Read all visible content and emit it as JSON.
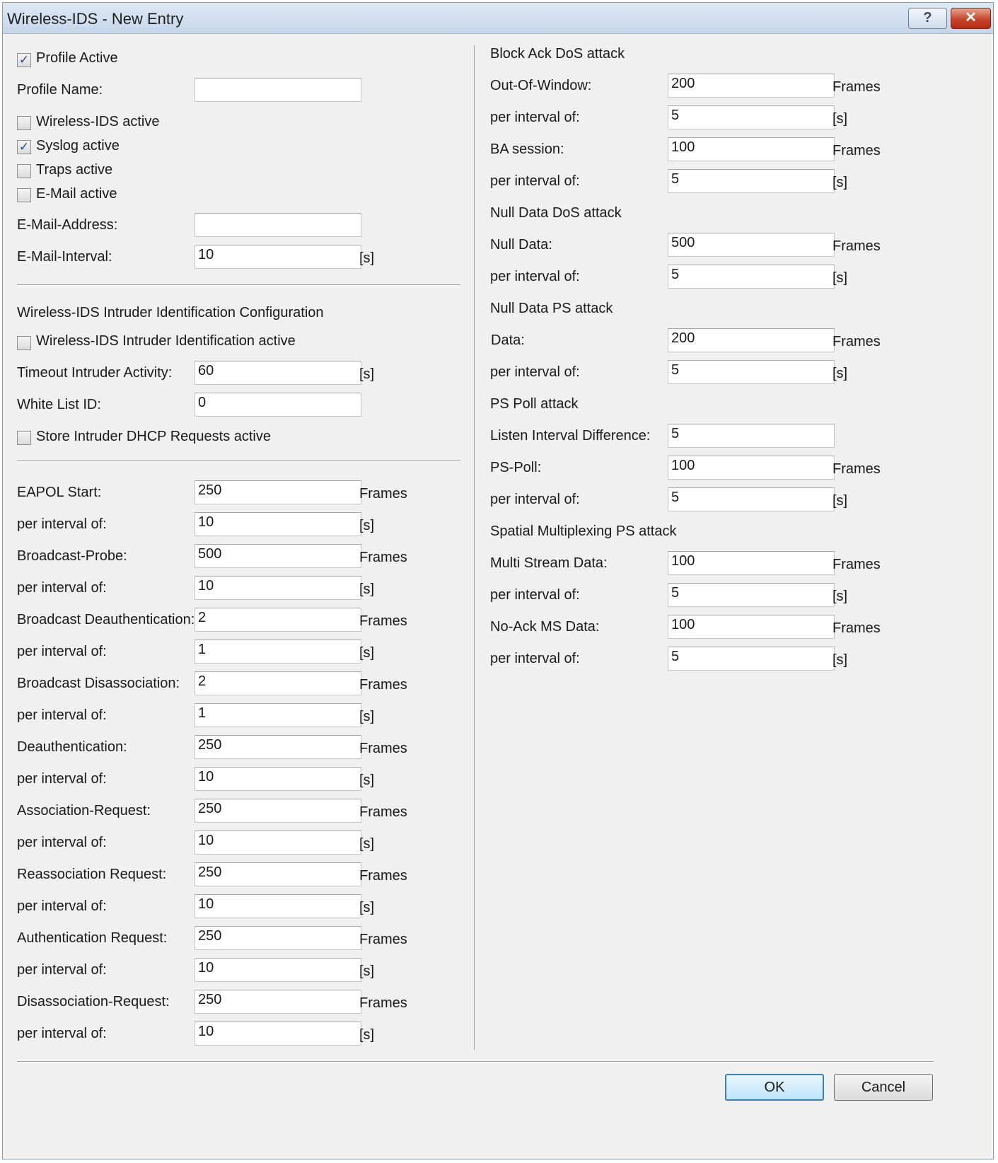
{
  "window": {
    "title": "Wireless-IDS - New Entry",
    "help_glyph": "?",
    "close_glyph": "✕"
  },
  "checkbox_glyph": "✓",
  "general": {
    "profile_active": {
      "label": "Profile Active",
      "checked": true
    },
    "profile_name": {
      "label": "Profile Name:",
      "value": ""
    },
    "wids_active": {
      "label": "Wireless-IDS active",
      "checked": false
    },
    "syslog_active": {
      "label": "Syslog active",
      "checked": true
    },
    "traps_active": {
      "label": "Traps active",
      "checked": false
    },
    "email_active": {
      "label": "E-Mail active",
      "checked": false
    },
    "email_address": {
      "label": "E-Mail-Address:",
      "value": ""
    },
    "email_interval": {
      "label": "E-Mail-Interval:",
      "value": "10",
      "unit": "[s]"
    }
  },
  "intruder": {
    "heading": "Wireless-IDS Intruder Identification Configuration",
    "active": {
      "label": "Wireless-IDS Intruder Identification active",
      "checked": false
    },
    "timeout": {
      "label": "Timeout Intruder Activity:",
      "value": "60",
      "unit": "[s]"
    },
    "whitelist": {
      "label": "White List ID:",
      "value": "0"
    },
    "store_dhcp": {
      "label": "Store Intruder DHCP Requests active",
      "checked": false
    }
  },
  "thresholds": [
    {
      "label": "EAPOL Start:",
      "value": "250",
      "unit": "Frames"
    },
    {
      "label": "per interval of:",
      "value": "10",
      "unit": "[s]"
    },
    {
      "label": "Broadcast-Probe:",
      "value": "500",
      "unit": "Frames"
    },
    {
      "label": "per interval of:",
      "value": "10",
      "unit": "[s]"
    },
    {
      "label": "Broadcast Deauthentication:",
      "value": "2",
      "unit": "Frames"
    },
    {
      "label": "per interval of:",
      "value": "1",
      "unit": "[s]"
    },
    {
      "label": "Broadcast Disassociation:",
      "value": "2",
      "unit": "Frames"
    },
    {
      "label": "per interval of:",
      "value": "1",
      "unit": "[s]"
    },
    {
      "label": "Deauthentication:",
      "value": "250",
      "unit": "Frames"
    },
    {
      "label": "per interval of:",
      "value": "10",
      "unit": "[s]"
    },
    {
      "label": "Association-Request:",
      "value": "250",
      "unit": "Frames"
    },
    {
      "label": "per interval of:",
      "value": "10",
      "unit": "[s]"
    },
    {
      "label": "Reassociation Request:",
      "value": "250",
      "unit": "Frames"
    },
    {
      "label": "per interval of:",
      "value": "10",
      "unit": "[s]"
    },
    {
      "label": "Authentication Request:",
      "value": "250",
      "unit": "Frames"
    },
    {
      "label": "per interval of:",
      "value": "10",
      "unit": "[s]"
    },
    {
      "label": "Disassociation-Request:",
      "value": "250",
      "unit": "Frames"
    },
    {
      "label": "per interval of:",
      "value": "10",
      "unit": "[s]"
    }
  ],
  "right": {
    "block_ack": {
      "heading": "Block Ack DoS attack",
      "out_of_window": {
        "label": "Out-Of-Window:",
        "value": "200",
        "unit": "Frames"
      },
      "oow_interval": {
        "label": "per interval of:",
        "value": "5",
        "unit": "[s]"
      },
      "ba_session": {
        "label": "BA session:",
        "value": "100",
        "unit": "Frames"
      },
      "ba_interval": {
        "label": "per interval of:",
        "value": "5",
        "unit": "[s]"
      }
    },
    "null_data_dos": {
      "heading": "Null Data DoS attack",
      "null_data": {
        "label": "Null Data:",
        "value": "500",
        "unit": "Frames"
      },
      "interval": {
        "label": "per interval of:",
        "value": "5",
        "unit": "[s]"
      }
    },
    "null_data_ps": {
      "heading": "Null Data PS attack",
      "data": {
        "label": "Data:",
        "value": "200",
        "unit": "Frames"
      },
      "interval": {
        "label": "per interval of:",
        "value": "5",
        "unit": "[s]"
      }
    },
    "ps_poll": {
      "heading": "PS Poll attack",
      "listen_diff": {
        "label": "Listen Interval Difference:",
        "value": "5"
      },
      "ps_poll": {
        "label": "PS-Poll:",
        "value": "100",
        "unit": "Frames"
      },
      "interval": {
        "label": "per interval of:",
        "value": "5",
        "unit": "[s]"
      }
    },
    "smps": {
      "heading": "Spatial Multiplexing PS attack",
      "multi_stream": {
        "label": "Multi Stream Data:",
        "value": "100",
        "unit": "Frames"
      },
      "ms_interval": {
        "label": "per interval of:",
        "value": "5",
        "unit": "[s]"
      },
      "no_ack": {
        "label": "No-Ack MS Data:",
        "value": "100",
        "unit": "Frames"
      },
      "na_interval": {
        "label": "per interval of:",
        "value": "5",
        "unit": "[s]"
      }
    }
  },
  "buttons": {
    "ok": "OK",
    "cancel": "Cancel"
  }
}
